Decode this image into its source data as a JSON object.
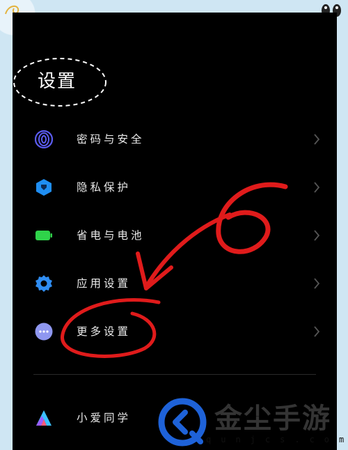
{
  "page": {
    "title": "设置"
  },
  "menu": [
    {
      "id": "password-security",
      "label": "密码与安全",
      "icon": "fingerprint-icon",
      "color": "#5b5cf0"
    },
    {
      "id": "privacy",
      "label": "隐私保护",
      "icon": "shield-icon",
      "color": "#1f8ef2"
    },
    {
      "id": "battery",
      "label": "省电与电池",
      "icon": "battery-icon",
      "color": "#2fd34a"
    },
    {
      "id": "app-settings",
      "label": "应用设置",
      "icon": "gear-icon",
      "color": "#2f8df2"
    },
    {
      "id": "more-settings",
      "label": "更多设置",
      "icon": "more-dots-icon",
      "color": "#8f97f0"
    },
    {
      "id": "xiaoai",
      "label": "小爱同学",
      "icon": "xiaoai-icon",
      "color": "#ff5a7a"
    }
  ],
  "annotation": {
    "color": "#e01b1b",
    "number": "6"
  },
  "watermark": {
    "brand": "金尘手游",
    "url": "qunjcs.com",
    "accent": "#1e62d8"
  }
}
